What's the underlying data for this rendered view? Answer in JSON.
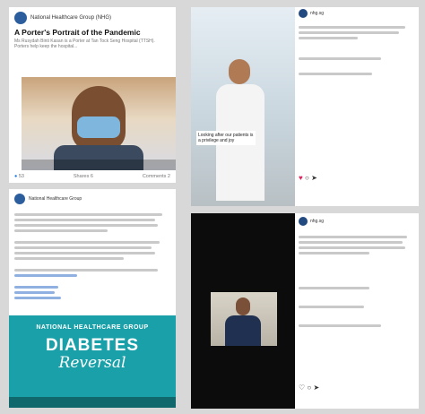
{
  "fb_post": {
    "page_name": "National Healthcare Group (NHG)",
    "post_title": "A Porter's Portrait of the Pandemic",
    "post_sub": "Ms Rusydah Binti Kasan is a Porter at Tan Tock Seng Hospital (TTSH). Porters help keep the hospital...",
    "reactions": "53",
    "shares_label": "Shares 6",
    "comments_label": "Comments 2"
  },
  "fb_video_post": {
    "page_name": "National Healthcare Group",
    "banner_top": "NATIONAL HEALTHCARE GROUP",
    "banner_main": "DIABETES",
    "banner_script": "Reversal"
  },
  "ig_post_top": {
    "username": "nhg.sg",
    "caption_overlay": "Looking after our patients is a privilege and joy"
  },
  "ig_post_bottom": {
    "username": "nhg.sg"
  },
  "colors": {
    "brand": "#1877f2",
    "teal": "#1aa0a8",
    "ig_red": "#e0245e"
  }
}
